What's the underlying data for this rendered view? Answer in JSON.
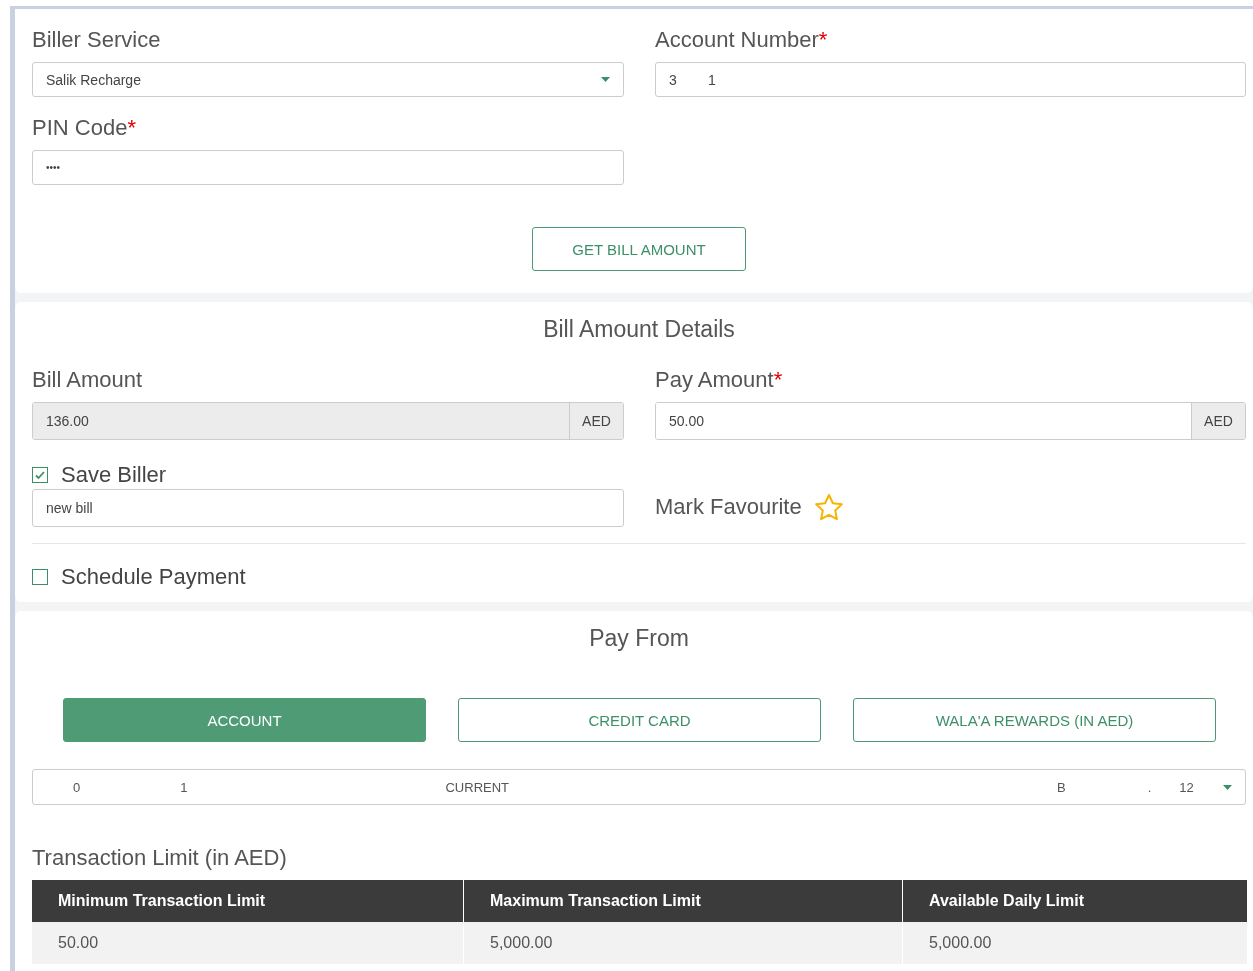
{
  "biller_service": {
    "label": "Biller Service",
    "value": "Salik Recharge"
  },
  "account_number": {
    "label": "Account Number",
    "required_mark": "*",
    "value": "3        1"
  },
  "pin_code": {
    "label": "PIN Code",
    "required_mark": "*",
    "value": "••••"
  },
  "get_bill_button": {
    "label": "GET BILL AMOUNT"
  },
  "bill_details": {
    "title": "Bill Amount Details",
    "bill_amount": {
      "label": "Bill Amount",
      "value": "136.00",
      "currency": "AED",
      "disabled": true
    },
    "pay_amount": {
      "label": "Pay Amount",
      "required_mark": "*",
      "value": "50.00",
      "currency": "AED",
      "disabled": false
    },
    "save_biller": {
      "label": "Save Biller",
      "checked": true,
      "value": "new bill"
    },
    "mark_favourite": {
      "label": "Mark Favourite",
      "starred": false
    },
    "schedule_payment": {
      "label": "Schedule Payment",
      "checked": false
    }
  },
  "pay_from": {
    "title": "Pay From",
    "tabs": [
      {
        "label": "ACCOUNT",
        "selected": true
      },
      {
        "label": "CREDIT CARD",
        "selected": false
      },
      {
        "label": "WALA'A REWARDS (IN AED)",
        "selected": false
      }
    ],
    "account_select": {
      "number_start": "0",
      "number_end": "1",
      "type": "CURRENT",
      "balance_label": "B",
      "balance_sep": ".",
      "balance_end": "12"
    }
  },
  "transaction_limit": {
    "title": "Transaction Limit (in AED)",
    "columns": [
      "Minimum Transaction Limit",
      "Maximum Transaction Limit",
      "Available Daily Limit"
    ],
    "rows": [
      [
        "50.00",
        "5,000.00",
        "5,000.00"
      ]
    ]
  }
}
